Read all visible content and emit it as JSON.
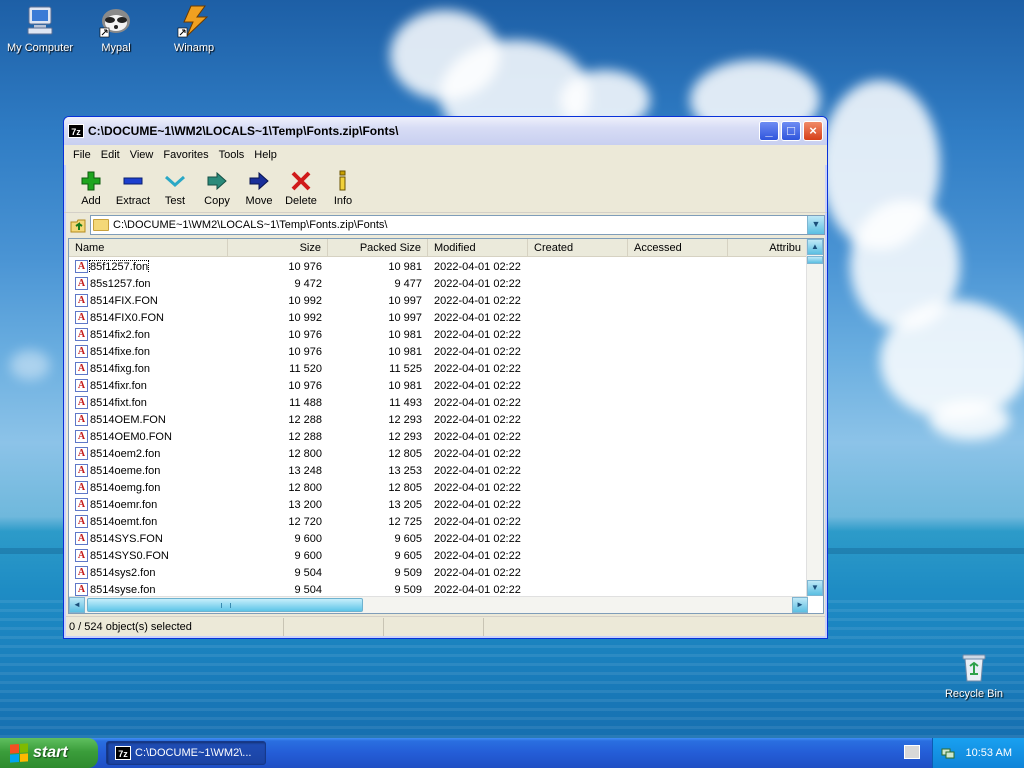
{
  "desktop": {
    "icons": [
      {
        "label": "My Computer"
      },
      {
        "label": "Mypal"
      },
      {
        "label": "Winamp"
      },
      {
        "label": "Recycle Bin"
      }
    ]
  },
  "window": {
    "app_icon": "7z",
    "title": "C:\\DOCUME~1\\WM2\\LOCALS~1\\Temp\\Fonts.zip\\Fonts\\",
    "menu": [
      "File",
      "Edit",
      "View",
      "Favorites",
      "Tools",
      "Help"
    ],
    "toolbar": [
      {
        "label": "Add",
        "icon": "plus-icon",
        "color": "#1ea51e"
      },
      {
        "label": "Extract",
        "icon": "minus-icon",
        "color": "#1c3fcf"
      },
      {
        "label": "Test",
        "icon": "check-chevron-icon",
        "color": "#2aa8c6"
      },
      {
        "label": "Copy",
        "icon": "double-arrow-icon",
        "color": "#2a8a7a"
      },
      {
        "label": "Move",
        "icon": "arrow-right-icon",
        "color": "#1a2f9a"
      },
      {
        "label": "Delete",
        "icon": "x-icon",
        "color": "#d01a1a"
      },
      {
        "label": "Info",
        "icon": "info-icon",
        "color": "#c8a000"
      }
    ],
    "address": "C:\\DOCUME~1\\WM2\\LOCALS~1\\Temp\\Fonts.zip\\Fonts\\",
    "columns": [
      "Name",
      "Size",
      "Packed Size",
      "Modified",
      "Created",
      "Accessed",
      "Attribu"
    ],
    "rows": [
      {
        "name": "85f1257.fon",
        "size": "10 976",
        "packed": "10 981",
        "modified": "2022-04-01 02:22"
      },
      {
        "name": "85s1257.fon",
        "size": "9 472",
        "packed": "9 477",
        "modified": "2022-04-01 02:22"
      },
      {
        "name": "8514FIX.FON",
        "size": "10 992",
        "packed": "10 997",
        "modified": "2022-04-01 02:22"
      },
      {
        "name": "8514FIX0.FON",
        "size": "10 992",
        "packed": "10 997",
        "modified": "2022-04-01 02:22"
      },
      {
        "name": "8514fix2.fon",
        "size": "10 976",
        "packed": "10 981",
        "modified": "2022-04-01 02:22"
      },
      {
        "name": "8514fixe.fon",
        "size": "10 976",
        "packed": "10 981",
        "modified": "2022-04-01 02:22"
      },
      {
        "name": "8514fixg.fon",
        "size": "11 520",
        "packed": "11 525",
        "modified": "2022-04-01 02:22"
      },
      {
        "name": "8514fixr.fon",
        "size": "10 976",
        "packed": "10 981",
        "modified": "2022-04-01 02:22"
      },
      {
        "name": "8514fixt.fon",
        "size": "11 488",
        "packed": "11 493",
        "modified": "2022-04-01 02:22"
      },
      {
        "name": "8514OEM.FON",
        "size": "12 288",
        "packed": "12 293",
        "modified": "2022-04-01 02:22"
      },
      {
        "name": "8514OEM0.FON",
        "size": "12 288",
        "packed": "12 293",
        "modified": "2022-04-01 02:22"
      },
      {
        "name": "8514oem2.fon",
        "size": "12 800",
        "packed": "12 805",
        "modified": "2022-04-01 02:22"
      },
      {
        "name": "8514oeme.fon",
        "size": "13 248",
        "packed": "13 253",
        "modified": "2022-04-01 02:22"
      },
      {
        "name": "8514oemg.fon",
        "size": "12 800",
        "packed": "12 805",
        "modified": "2022-04-01 02:22"
      },
      {
        "name": "8514oemr.fon",
        "size": "13 200",
        "packed": "13 205",
        "modified": "2022-04-01 02:22"
      },
      {
        "name": "8514oemt.fon",
        "size": "12 720",
        "packed": "12 725",
        "modified": "2022-04-01 02:22"
      },
      {
        "name": "8514SYS.FON",
        "size": "9 600",
        "packed": "9 605",
        "modified": "2022-04-01 02:22"
      },
      {
        "name": "8514SYS0.FON",
        "size": "9 600",
        "packed": "9 605",
        "modified": "2022-04-01 02:22"
      },
      {
        "name": "8514sys2.fon",
        "size": "9 504",
        "packed": "9 509",
        "modified": "2022-04-01 02:22"
      },
      {
        "name": "8514syse.fon",
        "size": "9 504",
        "packed": "9 509",
        "modified": "2022-04-01 02:22"
      }
    ],
    "status": {
      "selected": "0 / 524 object(s) selected"
    }
  },
  "taskbar": {
    "start_label": "start",
    "task_label": "C:\\DOCUME~1\\WM2\\...",
    "clock": "10:53 AM"
  },
  "colors": {
    "xp_blue": "#0831d9",
    "start_green": "#3b9d3b",
    "taskbar_blue": "#245dd7",
    "tray_blue": "#0f84d8"
  }
}
